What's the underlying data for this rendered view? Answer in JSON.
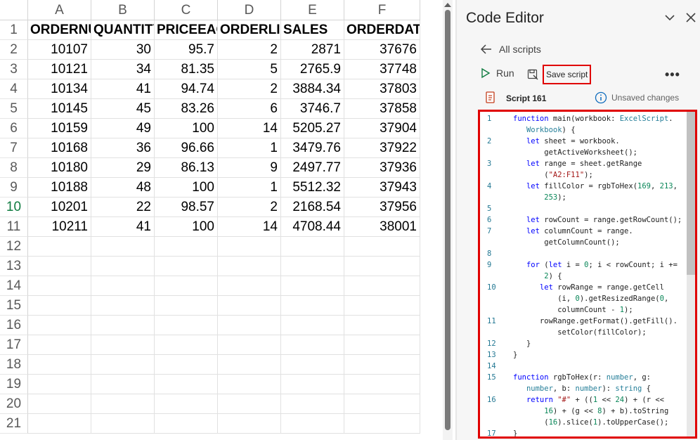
{
  "spreadsheet": {
    "columns": [
      "A",
      "B",
      "C",
      "D",
      "E",
      "F"
    ],
    "row_numbers": [
      "1",
      "2",
      "3",
      "4",
      "5",
      "6",
      "7",
      "8",
      "9",
      "10",
      "11",
      "12",
      "13",
      "14",
      "15",
      "16",
      "17",
      "18",
      "19",
      "20",
      "21"
    ],
    "active_row": "10",
    "header_cells": [
      "ORDERNUMBER",
      "QUANTITYORDERED",
      "PRICEEACH",
      "ORDERLINENUMBER",
      "SALES",
      "ORDERDATE"
    ],
    "rows": [
      [
        "10107",
        "30",
        "95.7",
        "2",
        "2871",
        "37676"
      ],
      [
        "10121",
        "34",
        "81.35",
        "5",
        "2765.9",
        "37748"
      ],
      [
        "10134",
        "41",
        "94.74",
        "2",
        "3884.34",
        "37803"
      ],
      [
        "10145",
        "45",
        "83.26",
        "6",
        "3746.7",
        "37858"
      ],
      [
        "10159",
        "49",
        "100",
        "14",
        "5205.27",
        "37904"
      ],
      [
        "10168",
        "36",
        "96.66",
        "1",
        "3479.76",
        "37922"
      ],
      [
        "10180",
        "29",
        "86.13",
        "9",
        "2497.77",
        "37936"
      ],
      [
        "10188",
        "48",
        "100",
        "1",
        "5512.32",
        "37943"
      ],
      [
        "10201",
        "22",
        "98.57",
        "2",
        "2168.54",
        "37956"
      ],
      [
        "10211",
        "41",
        "100",
        "14",
        "4708.44",
        "38001"
      ]
    ]
  },
  "editor": {
    "title": "Code Editor",
    "back_label": "All scripts",
    "run_label": "Run",
    "save_label": "Save script",
    "more_label": "•••",
    "script_name": "Script 161",
    "unsaved_label": "Unsaved changes",
    "icons": {
      "chevron": "chevron-down-icon",
      "close": "close-icon",
      "back": "arrow-left-icon",
      "run": "play-icon",
      "save": "save-icon",
      "script": "script-file-icon",
      "info": "info-icon"
    },
    "highlight_color": "#e00000"
  }
}
